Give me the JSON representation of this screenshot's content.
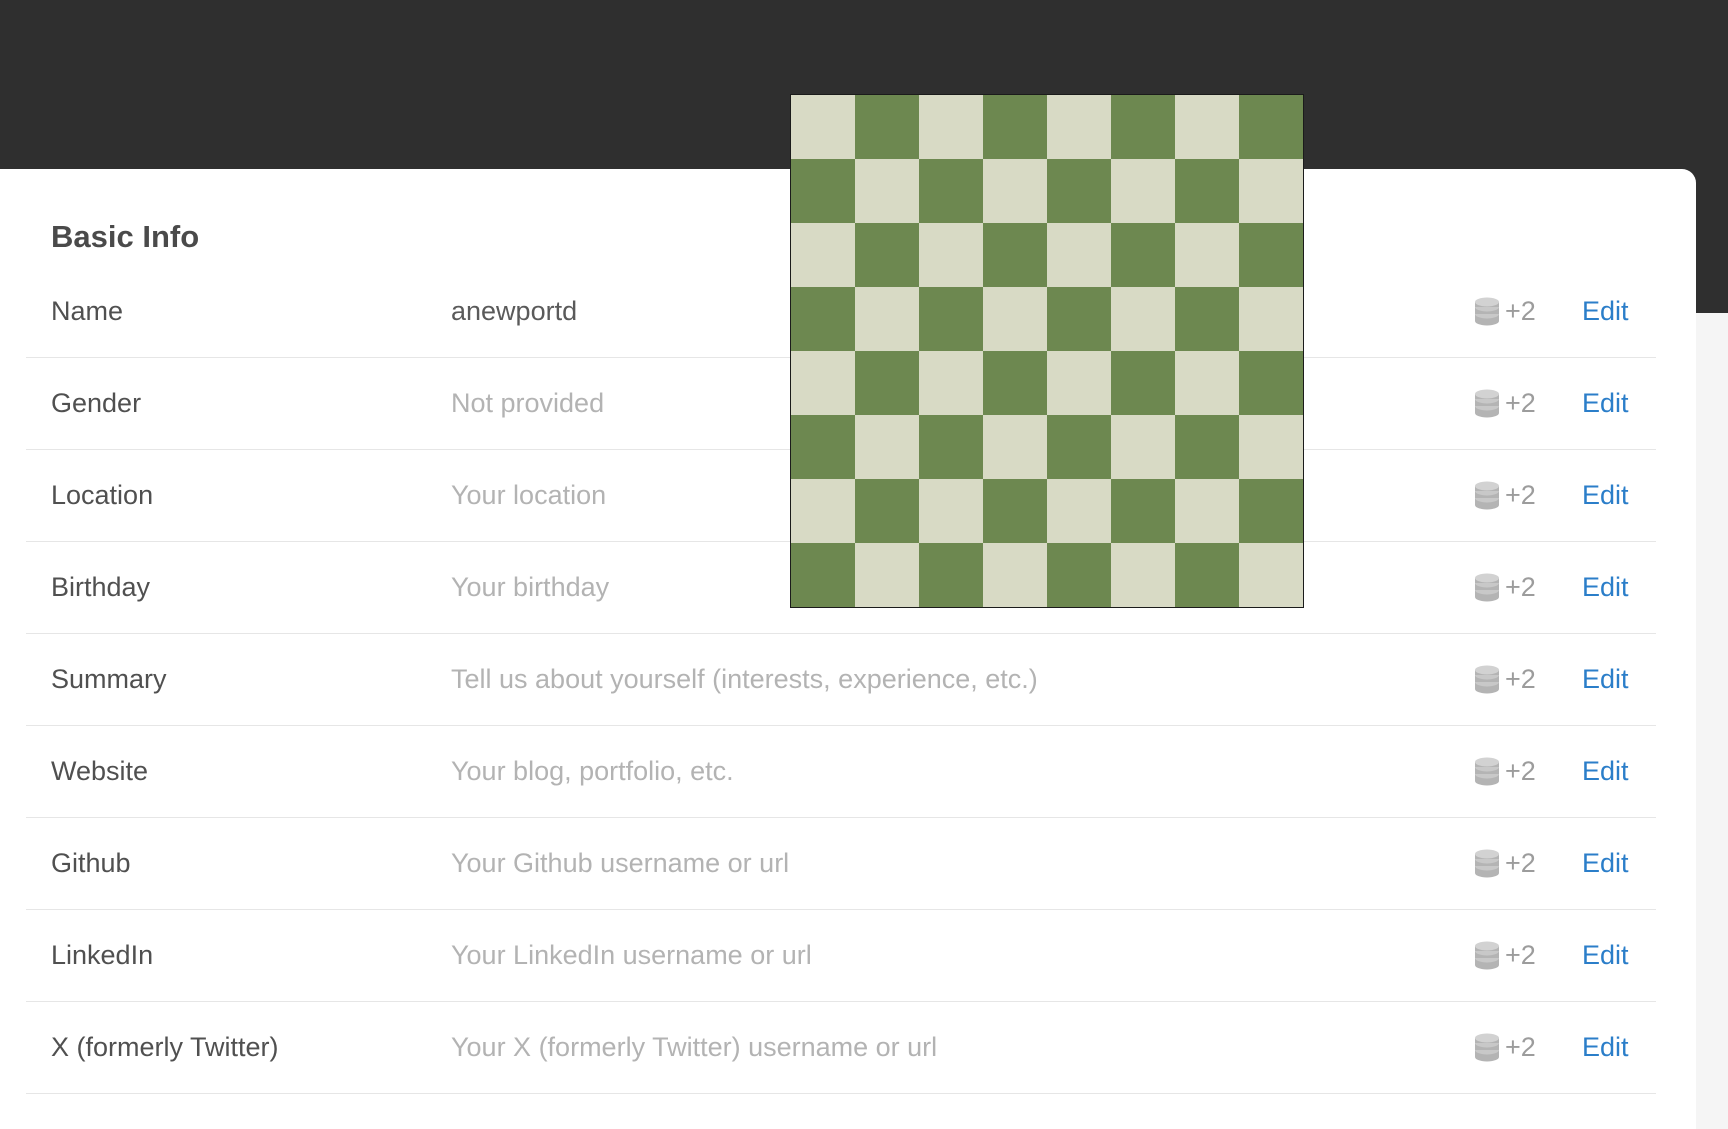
{
  "section": {
    "title": "Basic Info"
  },
  "colors": {
    "header_bg": "#2f2f2f",
    "edit_link": "#2b7ec9",
    "board_light": "#d8dac5",
    "board_dark": "#6d8850"
  },
  "fields": [
    {
      "label": "Name",
      "value": "anewportd",
      "filled": true,
      "points": "+2",
      "action": "Edit",
      "icon": "coin-stack-icon"
    },
    {
      "label": "Gender",
      "value": "Not provided",
      "filled": false,
      "points": "+2",
      "action": "Edit",
      "icon": "coin-stack-icon"
    },
    {
      "label": "Location",
      "value": "Your location",
      "filled": false,
      "points": "+2",
      "action": "Edit",
      "icon": "coin-stack-icon"
    },
    {
      "label": "Birthday",
      "value": "Your birthday",
      "filled": false,
      "points": "+2",
      "action": "Edit",
      "icon": "coin-stack-icon"
    },
    {
      "label": "Summary",
      "value": "Tell us about yourself (interests, experience, etc.)",
      "filled": false,
      "points": "+2",
      "action": "Edit",
      "icon": "coin-stack-icon"
    },
    {
      "label": "Website",
      "value": "Your blog, portfolio, etc.",
      "filled": false,
      "points": "+2",
      "action": "Edit",
      "icon": "coin-stack-icon"
    },
    {
      "label": "Github",
      "value": "Your Github username or url",
      "filled": false,
      "points": "+2",
      "action": "Edit",
      "icon": "coin-stack-icon"
    },
    {
      "label": "LinkedIn",
      "value": "Your LinkedIn username or url",
      "filled": false,
      "points": "+2",
      "action": "Edit",
      "icon": "coin-stack-icon"
    },
    {
      "label": "X (formerly Twitter)",
      "value": "Your X (formerly Twitter) username or url",
      "filled": false,
      "points": "+2",
      "action": "Edit",
      "icon": "coin-stack-icon"
    }
  ],
  "overlay": {
    "type": "chessboard",
    "files": 8,
    "ranks": 8,
    "top_left_square": "light"
  }
}
